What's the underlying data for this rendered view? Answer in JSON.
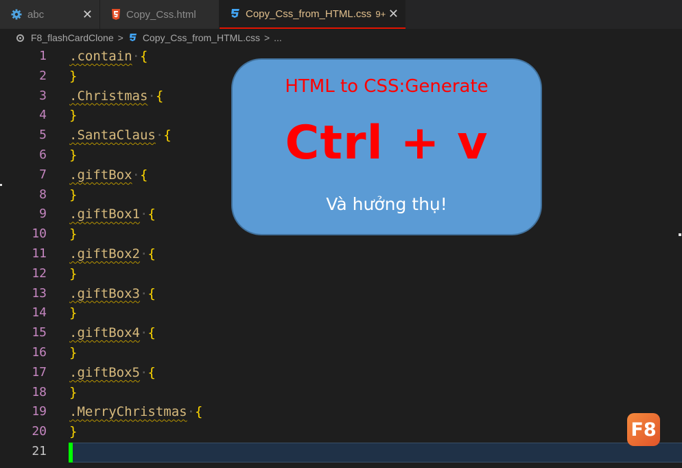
{
  "tabs": [
    {
      "label": "abc",
      "icon": "gear-icon",
      "close": "✕"
    },
    {
      "label": "Copy_Css.html",
      "icon": "html5-icon",
      "close": ""
    },
    {
      "label": "Copy_Css_from_HTML.css",
      "icon": "css3-icon",
      "badge": "9+",
      "close": "✕",
      "active": true
    }
  ],
  "breadcrumb": {
    "folder": "F8_flashCardClone",
    "file": "Copy_Css_from_HTML.css",
    "more": "...",
    "separator": ">"
  },
  "editor": {
    "lines": [
      {
        "n": "1",
        "selector": ".contain",
        "brace": "{"
      },
      {
        "n": "2",
        "brace": "}"
      },
      {
        "n": "3",
        "selector": ".Christmas",
        "brace": "{"
      },
      {
        "n": "4",
        "brace": "}"
      },
      {
        "n": "5",
        "selector": ".SantaClaus",
        "brace": "{"
      },
      {
        "n": "6",
        "brace": "}"
      },
      {
        "n": "7",
        "selector": ".giftBox",
        "brace": "{"
      },
      {
        "n": "8",
        "brace": "}"
      },
      {
        "n": "9",
        "selector": ".giftBox1",
        "brace": "{"
      },
      {
        "n": "10",
        "brace": "}"
      },
      {
        "n": "11",
        "selector": ".giftBox2",
        "brace": "{"
      },
      {
        "n": "12",
        "brace": "}"
      },
      {
        "n": "13",
        "selector": ".giftBox3",
        "brace": "{"
      },
      {
        "n": "14",
        "brace": "}"
      },
      {
        "n": "15",
        "selector": ".giftBox4",
        "brace": "{"
      },
      {
        "n": "16",
        "brace": "}"
      },
      {
        "n": "17",
        "selector": ".giftBox5",
        "brace": "{"
      },
      {
        "n": "18",
        "brace": "}"
      },
      {
        "n": "19",
        "selector": ".MerryChristmas",
        "brace": "{"
      },
      {
        "n": "20",
        "brace": "}"
      },
      {
        "n": "21",
        "current": true
      }
    ]
  },
  "overlay": {
    "title": "HTML to CSS:Generate",
    "shortcut": "Ctrl + v",
    "subtitle": "Và hưởng thụ!"
  },
  "logo": {
    "text": "F8"
  },
  "colors": {
    "accent_tab_border": "#e51400",
    "selector": "#d7ba7d",
    "brace": "#ffd700",
    "line_number": "#c586c0",
    "overlay_bg": "#5b9bd5",
    "overlay_text": "#ff0000",
    "cursor": "#00ff00"
  }
}
